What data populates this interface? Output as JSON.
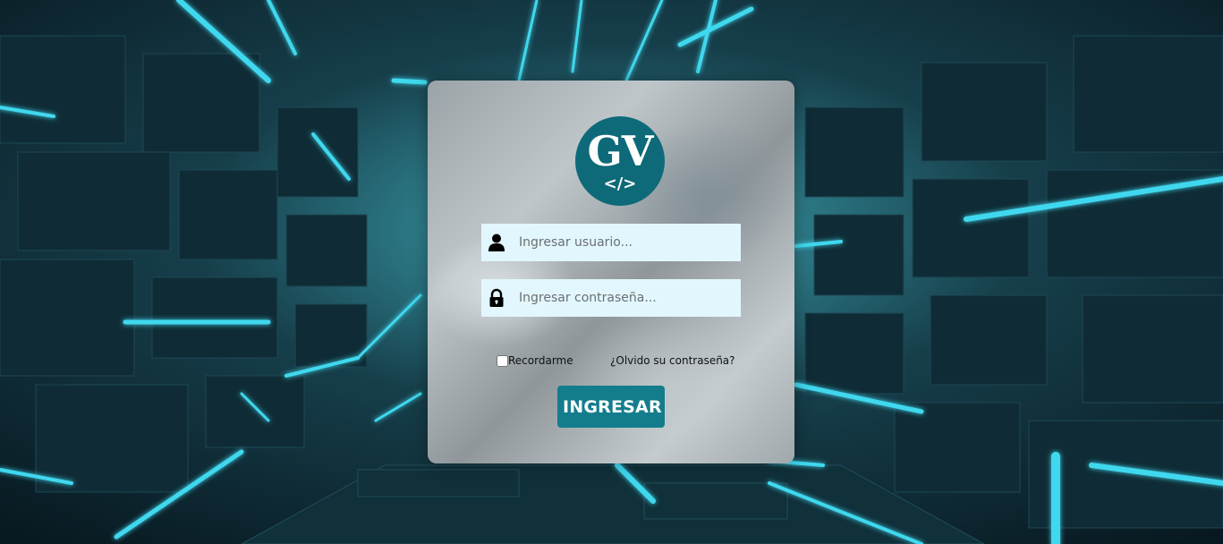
{
  "logo": {
    "letters": "GV",
    "code": "</>",
    "color": "#0e6a78"
  },
  "username": {
    "placeholder": "Ingresar usuario...",
    "value": "",
    "icon": "user-icon"
  },
  "password": {
    "placeholder": "Ingresar contraseña...",
    "value": "",
    "icon": "lock-icon"
  },
  "remember": {
    "label": "Recordarme",
    "checked": false
  },
  "forgot_link": "¿Olvido su contraseña?",
  "submit_label": "INGRESAR",
  "colors": {
    "accent": "#137d8c",
    "input_bg": "#e2f7fd",
    "neon": "#3fd8ee"
  }
}
